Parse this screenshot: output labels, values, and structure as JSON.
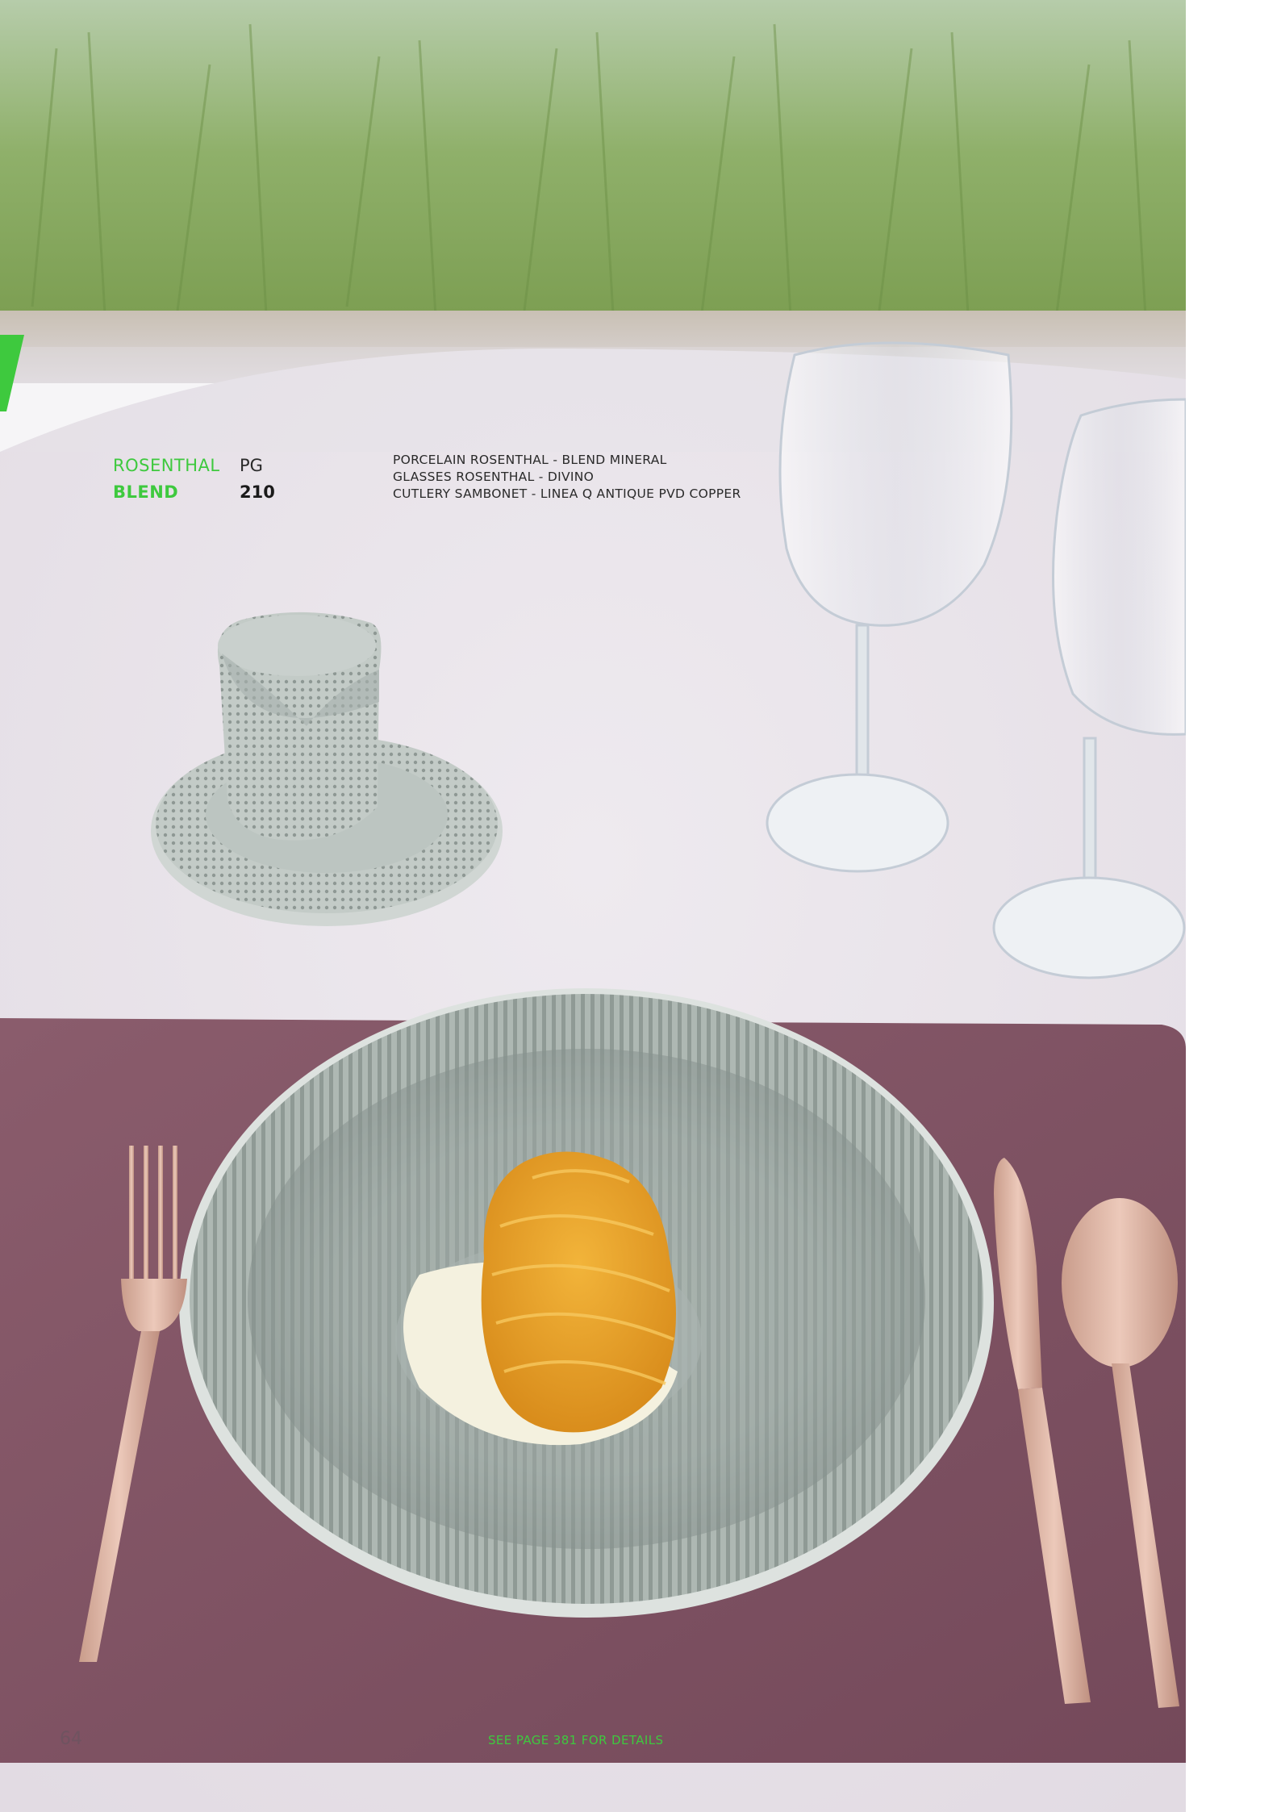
{
  "product": {
    "brand": "ROSENTHAL",
    "collection": "BLEND",
    "page_label": "PG",
    "page_ref": "210"
  },
  "specs": [
    "PORCELAIN  ROSENTHAL - BLEND MINERAL",
    "GLASSES ROSENTHAL - DIVINO",
    "CUTLERY SAMBONET - LINEA Q ANTIQUE PVD COPPER"
  ],
  "footer": {
    "page_number": "64",
    "note": "SEE PAGE 381 FOR DETAILS"
  },
  "colors": {
    "accent": "#3ec93e",
    "tablecloth": "#e9e4ea",
    "placemat": "#825565",
    "porcelain": "#a9b3af",
    "copper": "#d9b5a6"
  }
}
